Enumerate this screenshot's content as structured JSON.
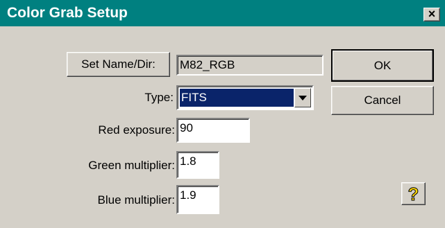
{
  "window": {
    "title": "Color Grab Setup",
    "close_glyph": "×"
  },
  "set_name": {
    "button_label": "Set Name/Dir:",
    "value": "M82_RGB"
  },
  "type": {
    "label": "Type:",
    "selected": "FITS"
  },
  "red_exposure": {
    "label": "Red exposure:",
    "value": "90"
  },
  "green_multiplier": {
    "label": "Green multiplier:",
    "value": "1.8"
  },
  "blue_multiplier": {
    "label": "Blue multiplier:",
    "value": "1.9"
  },
  "buttons": {
    "ok": "OK",
    "cancel": "Cancel",
    "help_glyph": "?"
  },
  "colors": {
    "titlebar": "#008080",
    "selection": "#0a246a",
    "dialog_bg": "#d4d0c8"
  },
  "icons": {
    "close": "close-icon",
    "dropdown": "chevron-down-icon",
    "help": "help-icon"
  }
}
